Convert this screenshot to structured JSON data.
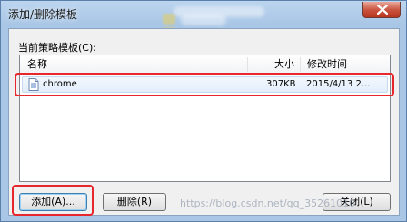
{
  "window": {
    "title": "添加/删除模板"
  },
  "group": {
    "label": "当前策略模板(C):"
  },
  "list": {
    "columns": [
      "名称",
      "大小",
      "修改时间"
    ],
    "rows": [
      {
        "name": "chrome",
        "size": "307KB",
        "modified": "2015/4/13 2..."
      }
    ]
  },
  "buttons": {
    "add": "添加(A)...",
    "remove": "删除(R)",
    "close": "关闭(L)"
  },
  "watermark": "https://blog.csdn.net/qq_35261010",
  "colors": {
    "highlight": "#e8262e",
    "selection": "#e3eefb"
  }
}
